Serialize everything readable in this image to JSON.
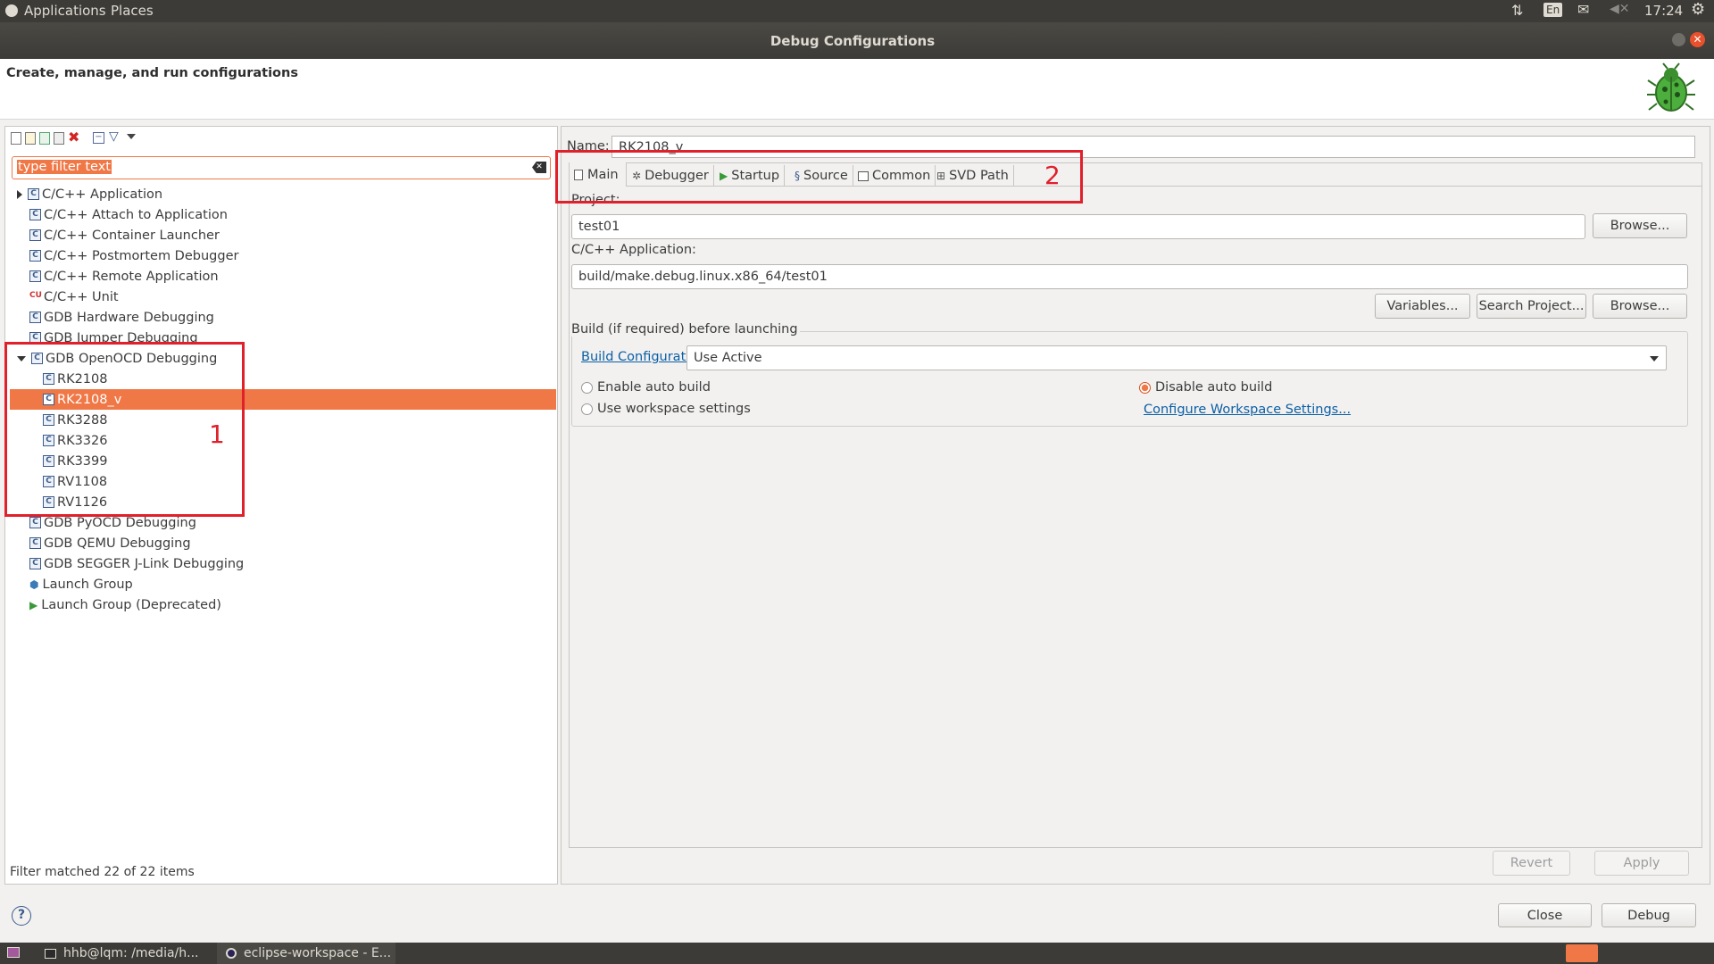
{
  "topbar": {
    "applications": "Applications",
    "places": "Places",
    "lang": "En",
    "time": "17:24"
  },
  "window": {
    "title": "Debug Configurations"
  },
  "header": {
    "title": "Create, manage, and run configurations"
  },
  "filter": {
    "placeholder": "type filter text"
  },
  "tree": {
    "items": [
      {
        "label": "C/C++ Application"
      },
      {
        "label": "C/C++ Attach to Application"
      },
      {
        "label": "C/C++ Container Launcher"
      },
      {
        "label": "C/C++ Postmortem Debugger"
      },
      {
        "label": "C/C++ Remote Application"
      },
      {
        "label": "C/C++ Unit"
      },
      {
        "label": "GDB Hardware Debugging"
      },
      {
        "label": "GDB Jumper Debugging"
      },
      {
        "label": "GDB OpenOCD Debugging"
      },
      {
        "label": "RK2108"
      },
      {
        "label": "RK2108_v"
      },
      {
        "label": "RK3288"
      },
      {
        "label": "RK3326"
      },
      {
        "label": "RK3399"
      },
      {
        "label": "RV1108"
      },
      {
        "label": "RV1126"
      },
      {
        "label": "GDB PyOCD Debugging"
      },
      {
        "label": "GDB QEMU Debugging"
      },
      {
        "label": "GDB SEGGER J-Link Debugging"
      },
      {
        "label": "Launch Group"
      },
      {
        "label": "Launch Group (Deprecated)"
      }
    ],
    "status": "Filter matched 22 of 22 items"
  },
  "annotations": {
    "box1": "1",
    "box2": "2"
  },
  "config": {
    "name_label": "Name:",
    "name_value": "RK2108_v",
    "tabs": [
      "Main",
      "Debugger",
      "Startup",
      "Source",
      "Common",
      "SVD Path"
    ],
    "project_label": "Project:",
    "project_value": "test01",
    "browse": "Browse...",
    "app_label": "C/C++ Application:",
    "app_value": "build/make.debug.linux.x86_64/test01",
    "variables": "Variables...",
    "search_project": "Search Project...",
    "build_group": "Build (if required) before launching",
    "build_config_link": "Build Configuration:",
    "build_config_value": "Use Active",
    "enable_auto": "Enable auto build",
    "disable_auto": "Disable auto build",
    "use_workspace": "Use workspace settings",
    "configure_workspace": "Configure Workspace Settings...",
    "revert": "Revert",
    "apply": "Apply"
  },
  "footer": {
    "close": "Close",
    "debug": "Debug"
  },
  "taskbar": {
    "terminal": "hhb@lqm: /media/h...",
    "eclipse": "eclipse-workspace - E..."
  }
}
